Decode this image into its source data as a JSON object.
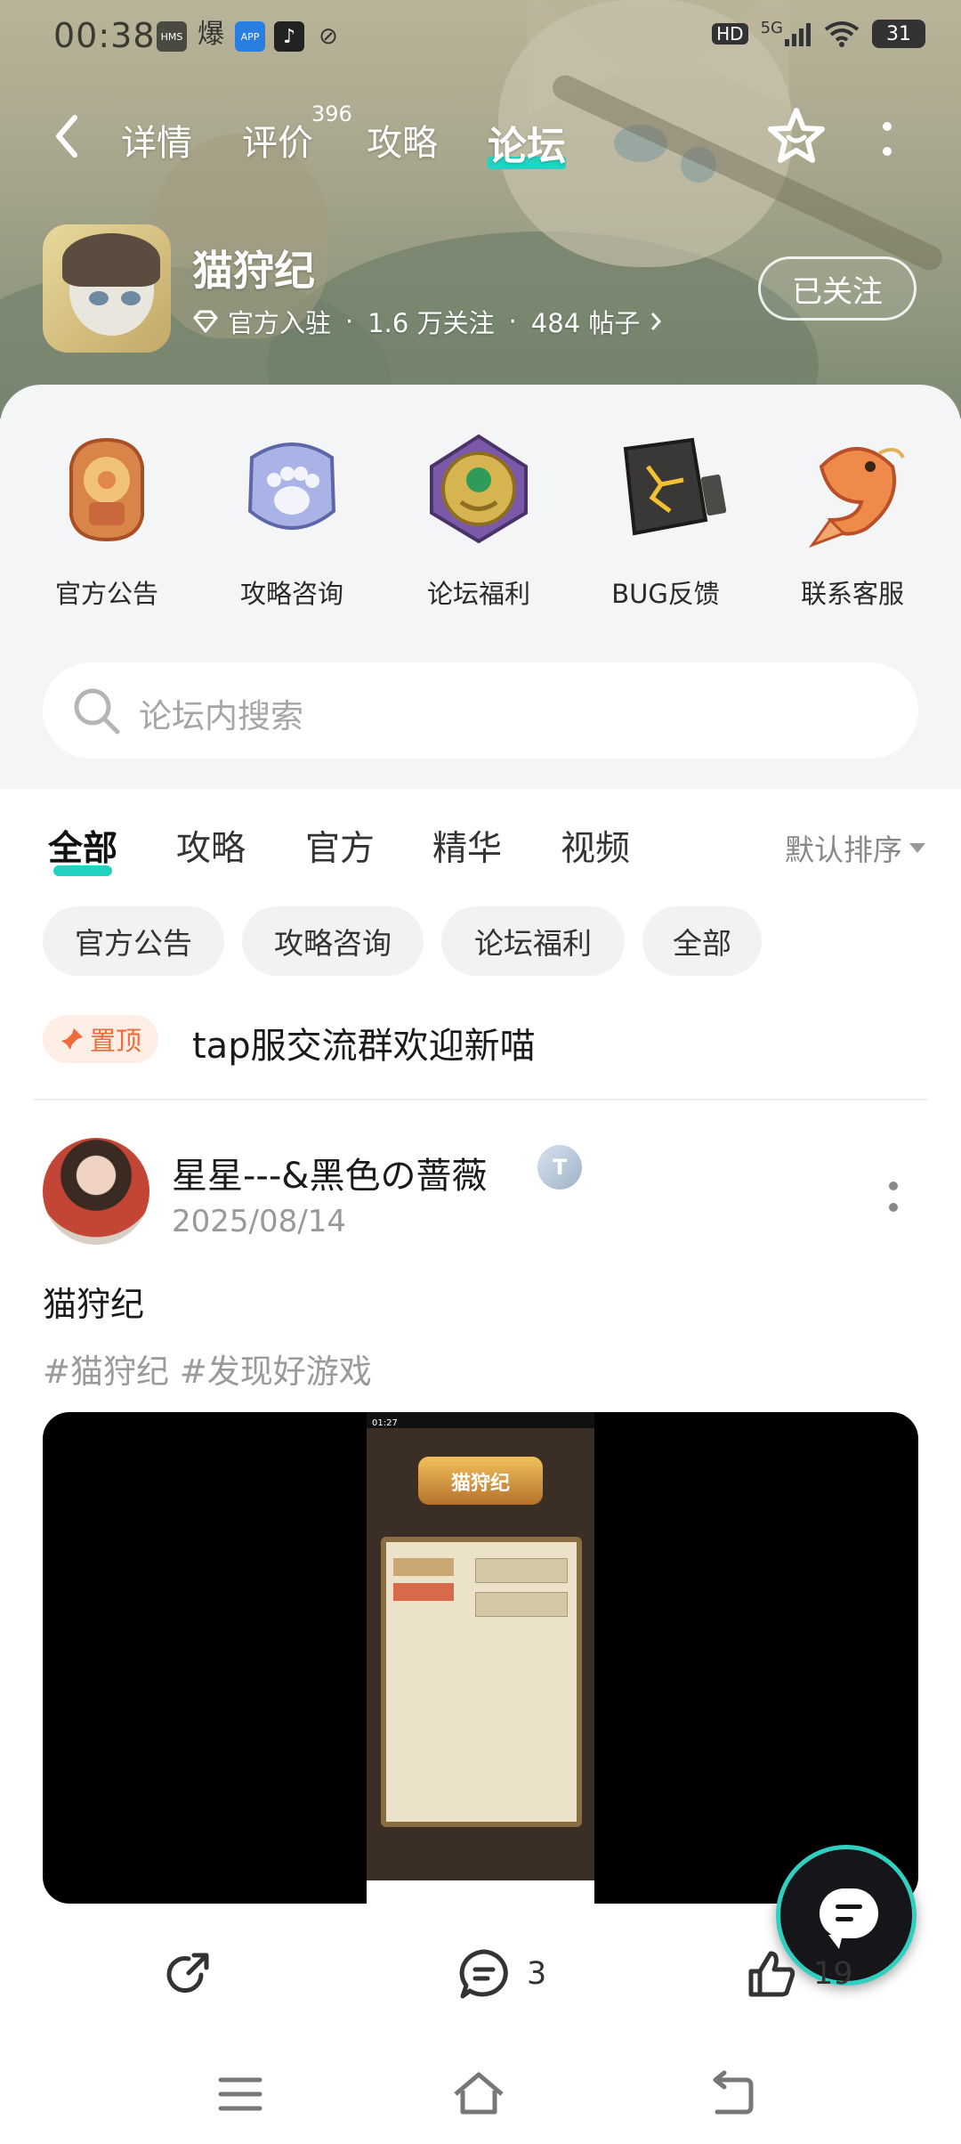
{
  "status_bar": {
    "time": "00:38",
    "app_icons": [
      "HMS",
      "爆",
      "APP",
      "♪",
      "⊘"
    ],
    "network": "5G",
    "hd": "HD",
    "battery": "31"
  },
  "nav": {
    "tabs": [
      {
        "label": "详情"
      },
      {
        "label": "评价"
      },
      {
        "label": "攻略"
      },
      {
        "label": "论坛"
      }
    ],
    "active_tab": "论坛",
    "review_count": "396",
    "accent_color": "#23d3c1"
  },
  "game": {
    "name": "猫狩纪",
    "official": "官方入驻",
    "followers": "1.6 万关注",
    "posts": "484 帖子",
    "separator": "·",
    "follow_label": "已关注"
  },
  "categories": [
    {
      "label": "官方公告",
      "icon": "announcement-badge-icon"
    },
    {
      "label": "攻略咨询",
      "icon": "paw-badge-icon"
    },
    {
      "label": "论坛福利",
      "icon": "gem-medal-icon"
    },
    {
      "label": "BUG反馈",
      "icon": "cracked-stone-icon"
    },
    {
      "label": "联系客服",
      "icon": "koi-fish-icon"
    }
  ],
  "search": {
    "placeholder": "论坛内搜索"
  },
  "filter_tabs": {
    "tabs": [
      "全部",
      "攻略",
      "官方",
      "精华",
      "视频"
    ],
    "active": "全部",
    "sort_label": "默认排序"
  },
  "chips": [
    "官方公告",
    "攻略咨询",
    "论坛福利",
    "全部"
  ],
  "pinned": {
    "badge": "置顶",
    "text": "tap服交流群欢迎新喵"
  },
  "post": {
    "username": "星星---&黑色の蔷薇",
    "level_badge": "T",
    "date": "2025/08/14",
    "title": "猫狩纪",
    "tags": "#猫狩纪 #发现好游戏",
    "video_screen": {
      "time": "01:27",
      "game_logo": "猫狩纪"
    },
    "comments": "3",
    "likes": "19"
  }
}
